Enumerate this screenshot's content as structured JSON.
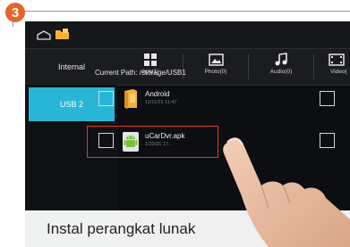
{
  "step": {
    "number": "3"
  },
  "topbar": {
    "icons": [
      "home-icon",
      "folder-icon"
    ]
  },
  "toolbar": {
    "internal_label": "Internal",
    "tabs": [
      {
        "label": "Apk(1)",
        "icon": "apk-icon"
      },
      {
        "label": "Photo(0)",
        "icon": "photo-icon"
      },
      {
        "label": "Audio(0)",
        "icon": "audio-icon"
      },
      {
        "label": "Video(",
        "icon": "video-icon"
      }
    ]
  },
  "sidebar": {
    "items": [
      {
        "label": "USB 2",
        "selected": true
      }
    ]
  },
  "main": {
    "path": "Current Path: /storage/USB1",
    "files": [
      {
        "name": "Android",
        "date": "11/11/21 11:47",
        "icon": "folder-icon"
      },
      {
        "name": "uCarDvr.apk",
        "date": "1/22/21 17...",
        "icon": "android-icon"
      }
    ]
  },
  "caption": "Instal perangkat lunak",
  "colors": {
    "accent": "#29b6d6",
    "badge": "#e8632b",
    "highlight": "#e23a2c"
  }
}
